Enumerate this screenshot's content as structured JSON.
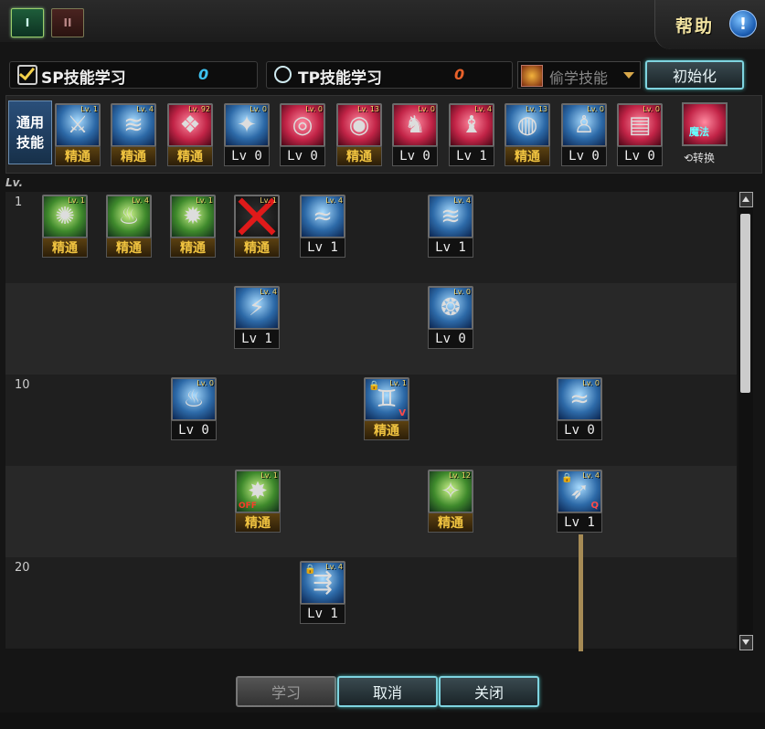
{
  "tabs": [
    {
      "label": "I",
      "icon": "skill-tab-1-icon"
    },
    {
      "label": "II",
      "icon": "skill-tab-2-icon"
    }
  ],
  "help": {
    "label": "帮助",
    "icon_text": "!"
  },
  "sp": {
    "label": "SP技能学习",
    "value": "0"
  },
  "tp": {
    "label": "TP技能学习",
    "value": "0"
  },
  "steal": {
    "label": "偷学技能"
  },
  "reset": {
    "label": "初始化"
  },
  "general": {
    "label_line1": "通用",
    "label_line2": "技能",
    "swap_icon_text": "魔法",
    "swap_label": "⟲转换",
    "skills": [
      {
        "lv": "Lv. 1",
        "label": "精通",
        "color": "blue",
        "glyph": "⚔"
      },
      {
        "lv": "Lv. 4",
        "label": "精通",
        "color": "blue",
        "glyph": "≋"
      },
      {
        "lv": "Lv. 92",
        "label": "精通",
        "color": "red",
        "glyph": "❖"
      },
      {
        "lv": "Lv. 0",
        "label": "Lv 0",
        "color": "blue",
        "glyph": "✦"
      },
      {
        "lv": "Lv. 0",
        "label": "Lv 0",
        "color": "red",
        "glyph": "◎"
      },
      {
        "lv": "Lv. 13",
        "label": "精通",
        "color": "red",
        "glyph": "◉"
      },
      {
        "lv": "Lv. 0",
        "label": "Lv 0",
        "color": "red",
        "glyph": "♞"
      },
      {
        "lv": "Lv. 4",
        "label": "Lv 1",
        "color": "red",
        "glyph": "♝"
      },
      {
        "lv": "Lv. 13",
        "label": "精通",
        "color": "blue",
        "glyph": "◍"
      },
      {
        "lv": "Lv. 0",
        "label": "Lv 0",
        "color": "blue",
        "glyph": "♙"
      },
      {
        "lv": "Lv. 0",
        "label": "Lv 0",
        "color": "red",
        "glyph": "▤"
      }
    ]
  },
  "tree": {
    "lv_header": "Lv.",
    "levels": [
      "1",
      "10",
      "20"
    ],
    "skills": [
      {
        "lv": "Lv. 1",
        "label": "精通",
        "color": "green",
        "glyph": "✺"
      },
      {
        "lv": "Lv. 4",
        "label": "精通",
        "color": "green",
        "glyph": "♨"
      },
      {
        "lv": "Lv. 1",
        "label": "精通",
        "color": "green",
        "glyph": "✹"
      },
      {
        "lv": "Lv. 1",
        "label": "精通",
        "color": "dark",
        "glyph": ""
      },
      {
        "lv": "Lv. 4",
        "label": "Lv 1",
        "color": "blue",
        "glyph": "≈"
      },
      {
        "lv": "Lv. 4",
        "label": "Lv 1",
        "color": "blue",
        "glyph": "≋"
      },
      {
        "lv": "Lv. 4",
        "label": "Lv 1",
        "color": "blue",
        "glyph": "⚡"
      },
      {
        "lv": "Lv. 0",
        "label": "Lv 0",
        "color": "blue",
        "glyph": "❂"
      },
      {
        "lv": "Lv. 0",
        "label": "Lv 0",
        "color": "blue",
        "glyph": "♨"
      },
      {
        "lv": "Lv. 1",
        "label": "精通",
        "color": "blue",
        "glyph": "♊"
      },
      {
        "lv": "Lv. 0",
        "label": "Lv 0",
        "color": "blue",
        "glyph": "≈"
      },
      {
        "lv": "Lv. 1",
        "label": "精通",
        "color": "green",
        "glyph": "✸"
      },
      {
        "lv": "Lv. 12",
        "label": "精通",
        "color": "green",
        "glyph": "✧"
      },
      {
        "lv": "Lv. 4",
        "label": "Lv 1",
        "color": "blue",
        "glyph": "➶"
      },
      {
        "lv": "Lv. 4",
        "label": "Lv 1",
        "color": "blue",
        "glyph": "⇶"
      }
    ],
    "off_text": "OFF",
    "v_mark": "V",
    "q_mark": "Q"
  },
  "buttons": {
    "learn": "学习",
    "cancel": "取消",
    "close": "关闭"
  }
}
